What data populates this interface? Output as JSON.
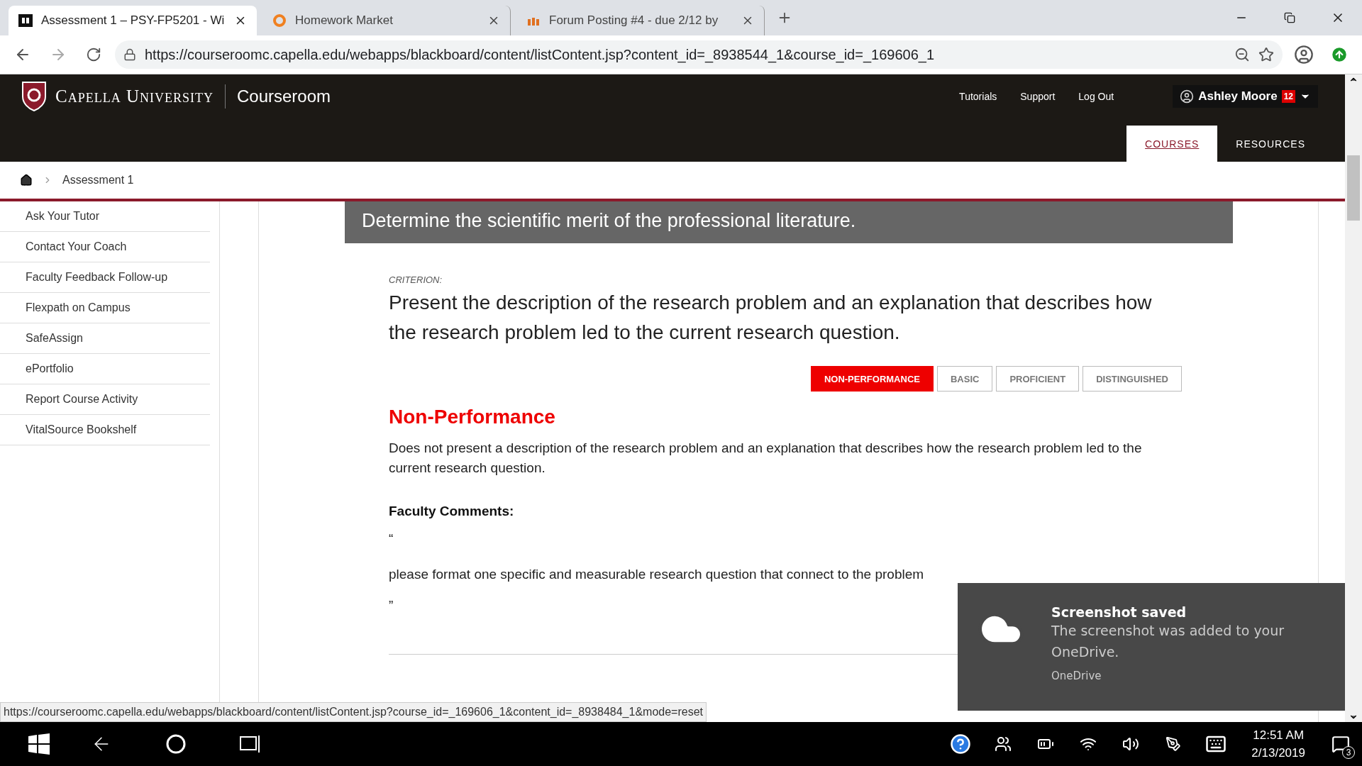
{
  "browser": {
    "tabs": [
      {
        "label": "Assessment 1 – PSY-FP5201 - Wi",
        "selected": true,
        "kind": "bb"
      },
      {
        "label": "Homework Market",
        "selected": false,
        "kind": "ring"
      },
      {
        "label": "Forum Posting #4 - due 2/12 by",
        "selected": false,
        "kind": "m"
      }
    ],
    "address": "https://courseroomc.capella.edu/webapps/blackboard/content/listContent.jsp?content_id=_8938544_1&course_id=_169606_1"
  },
  "header": {
    "brand": "Capella University",
    "product": "Courseroom",
    "links": [
      "Tutorials",
      "Support",
      "Log Out"
    ],
    "user": "Ashley Moore",
    "notifications": "12",
    "nav": [
      {
        "label": "COURSES",
        "selected": true
      },
      {
        "label": "RESOURCES",
        "selected": false
      }
    ]
  },
  "breadcrumb": [
    "Assessment 1"
  ],
  "sidebar": {
    "items": [
      "Ask Your Tutor",
      "Contact Your Coach",
      "Faculty Feedback Follow-up",
      "Flexpath on Campus",
      "SafeAssign",
      "ePortfolio",
      "Report Course Activity",
      "VitalSource Bookshelf"
    ]
  },
  "competency": {
    "text": "Determine the scientific merit of the professional literature."
  },
  "criterion": {
    "label": "CRITERION:",
    "text": "Present the description of the research problem and an explanation that describes how the research problem led to the current research question.",
    "levels": [
      {
        "label": "NON-PERFORMANCE",
        "selected": true
      },
      {
        "label": "BASIC",
        "selected": false
      },
      {
        "label": "PROFICIENT",
        "selected": false
      },
      {
        "label": "DISTINGUISHED",
        "selected": false
      }
    ],
    "level_title": "Non-Performance",
    "level_text": "Does not present a description of the research problem and an explanation that describes how the research problem led to the current research question.",
    "comments_title": "Faculty Comments:",
    "open_quote": "“",
    "comment": "please format one specific and measurable research question that connect to the problem",
    "close_quote": "”"
  },
  "status_url": "https://courseroomc.capella.edu/webapps/blackboard/content/listContent.jsp?course_id=_169606_1&content_id=_8938484_1&mode=reset",
  "toast": {
    "title": "Screenshot saved",
    "body": "The screenshot was added to your OneDrive.",
    "source": "OneDrive"
  },
  "taskbar": {
    "time": "12:51 AM",
    "date": "2/13/2019",
    "notifications": "3"
  }
}
